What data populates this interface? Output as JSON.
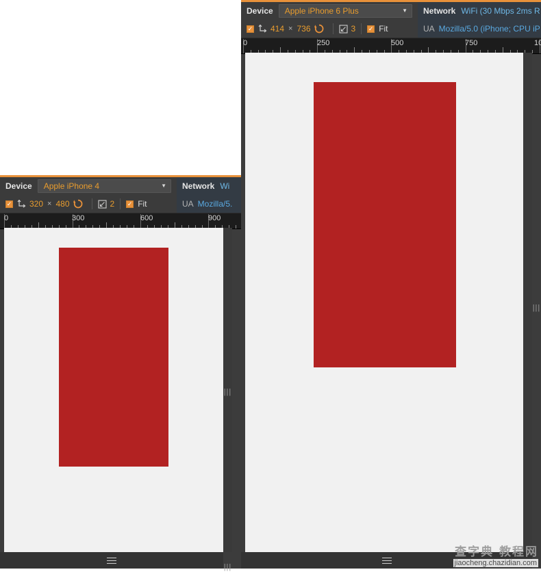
{
  "panels": [
    {
      "id": "iphone6plus",
      "device": {
        "label": "Device",
        "value": "Apple iPhone 6 Plus",
        "caret_icon": "chevron-down-icon"
      },
      "dimensions": {
        "enabled_checkbox": "checked",
        "check_glyph": "✓",
        "orientation_icon": "rotate-dimensions-icon",
        "width": "414",
        "separator": "×",
        "height": "736",
        "swap_icon": "swap-orientation-icon",
        "zoom_icon": "zoom-icon",
        "zoom_value": "3",
        "fit_checkbox": "checked",
        "fit_label": "Fit"
      },
      "network": {
        "label": "Network",
        "value": "WiFi (30 Mbps 2ms R",
        "ua_label": "UA",
        "ua_value": "Mozilla/5.0 (iPhone; CPU iP"
      },
      "ruler": {
        "labels": [
          "0",
          "250",
          "500",
          "750",
          "10"
        ],
        "major_step": 250
      },
      "content": {
        "box_color": "#b22222"
      },
      "bottom_bar": {
        "menu_icon": "hamburger-menu-icon"
      }
    },
    {
      "id": "iphone4",
      "device": {
        "label": "Device",
        "value": "Apple iPhone 4",
        "caret_icon": "chevron-down-icon"
      },
      "dimensions": {
        "enabled_checkbox": "checked",
        "check_glyph": "✓",
        "orientation_icon": "rotate-dimensions-icon",
        "width": "320",
        "separator": "×",
        "height": "480",
        "swap_icon": "swap-orientation-icon",
        "zoom_icon": "zoom-icon",
        "zoom_value": "2",
        "fit_checkbox": "checked",
        "fit_label": "Fit"
      },
      "network": {
        "label": "Network",
        "value": "Wi",
        "ua_label": "UA",
        "ua_value": "Mozilla/5."
      },
      "ruler": {
        "labels": [
          "0",
          "300",
          "600",
          "900"
        ],
        "major_step": 300
      },
      "content": {
        "box_color": "#b22222"
      },
      "bottom_bar": {
        "menu_icon": "hamburger-menu-icon"
      }
    }
  ],
  "theme": {
    "accent": "#e8913a",
    "value_orange": "#e89c2e",
    "link_blue": "#5aa9e0",
    "panel_bg": "#3c3c3c",
    "viewport_bg": "#f1f1f1"
  },
  "watermark": {
    "cn": "查字典 教程网",
    "url": "jiaocheng.chazidian.com"
  }
}
